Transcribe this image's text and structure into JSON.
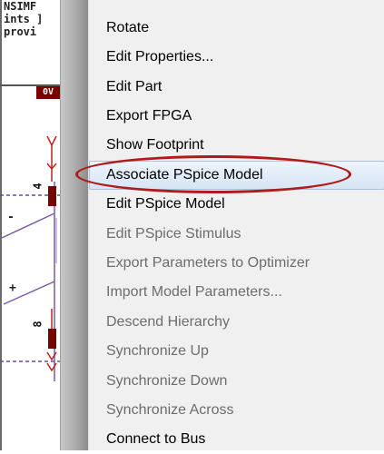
{
  "schematic": {
    "code_lines": [
      "NSIMF",
      "ints ]",
      "provi"
    ],
    "net_tag": "0V",
    "pin_top": "4",
    "pin_bottom": "8",
    "sign_minus": "-",
    "sign_plus": "+"
  },
  "menu": {
    "highlight_color": "#b11a1a",
    "items": [
      {
        "label": "Rotate",
        "enabled": true
      },
      {
        "label": "Edit Properties...",
        "enabled": true
      },
      {
        "label": "Edit Part",
        "enabled": true
      },
      {
        "label": "Export FPGA",
        "enabled": true
      },
      {
        "label": "Show Footprint",
        "enabled": true
      },
      {
        "label": "Associate PSpice Model",
        "enabled": true,
        "highlighted": true
      },
      {
        "label": "Edit PSpice Model",
        "enabled": true
      },
      {
        "label": "Edit PSpice Stimulus",
        "enabled": false
      },
      {
        "label": "Export Parameters to Optimizer",
        "enabled": false
      },
      {
        "label": "Import Model Parameters...",
        "enabled": false
      },
      {
        "label": "Descend Hierarchy",
        "enabled": false
      },
      {
        "label": "Synchronize Up",
        "enabled": false
      },
      {
        "label": "Synchronize Down",
        "enabled": false
      },
      {
        "label": "Synchronize Across",
        "enabled": false
      },
      {
        "label": "Connect to Bus",
        "enabled": true
      }
    ]
  }
}
